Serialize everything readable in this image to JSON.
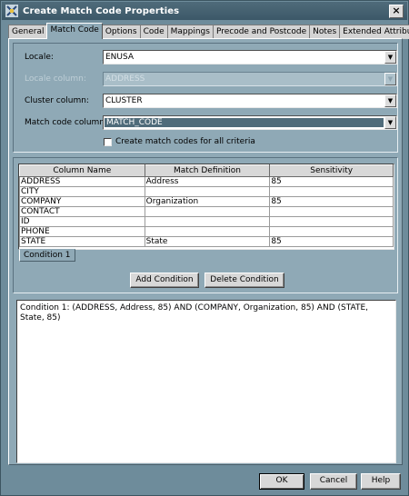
{
  "window": {
    "title": "Create Match Code Properties"
  },
  "tabs": [
    "General",
    "Match Code",
    "Options",
    "Code",
    "Mappings",
    "Precode and Postcode",
    "Notes",
    "Extended Attributes"
  ],
  "form": {
    "locale_label": "Locale:",
    "locale_value": "ENUSA",
    "locale_column_label": "Locale column:",
    "locale_column_value": "ADDRESS",
    "cluster_column_label": "Cluster column:",
    "cluster_column_value": "CLUSTER",
    "match_code_column_label": "Match code column:",
    "match_code_column_value": "MATCH_CODE",
    "create_all_label": "Create match codes for all criteria"
  },
  "table": {
    "headers": [
      "Column Name",
      "Match Definition",
      "Sensitivity"
    ],
    "rows": [
      [
        "ADDRESS",
        "Address",
        "85"
      ],
      [
        "CITY",
        "",
        ""
      ],
      [
        "COMPANY",
        "Organization",
        "85"
      ],
      [
        "CONTACT",
        "",
        ""
      ],
      [
        "ID",
        "",
        ""
      ],
      [
        "PHONE",
        "",
        ""
      ],
      [
        "STATE",
        "State",
        "85"
      ]
    ]
  },
  "condition_tab": "Condition 1",
  "buttons": {
    "add_condition": "Add Condition",
    "delete_condition": "Delete Condition",
    "ok": "OK",
    "cancel": "Cancel",
    "help": "Help"
  },
  "condition_text": "Condition 1: (ADDRESS, Address, 85) AND (COMPANY, Organization, 85) AND (STATE, State, 85)",
  "icons": {
    "title": "match-code-icon",
    "close": "close-icon",
    "dropdown": "chevron-down-icon"
  },
  "colors": {
    "background": "#6e8c9b",
    "panel": "#8fa9b6",
    "titlebar": "#3c5868",
    "selection": "#4f6b7a"
  }
}
